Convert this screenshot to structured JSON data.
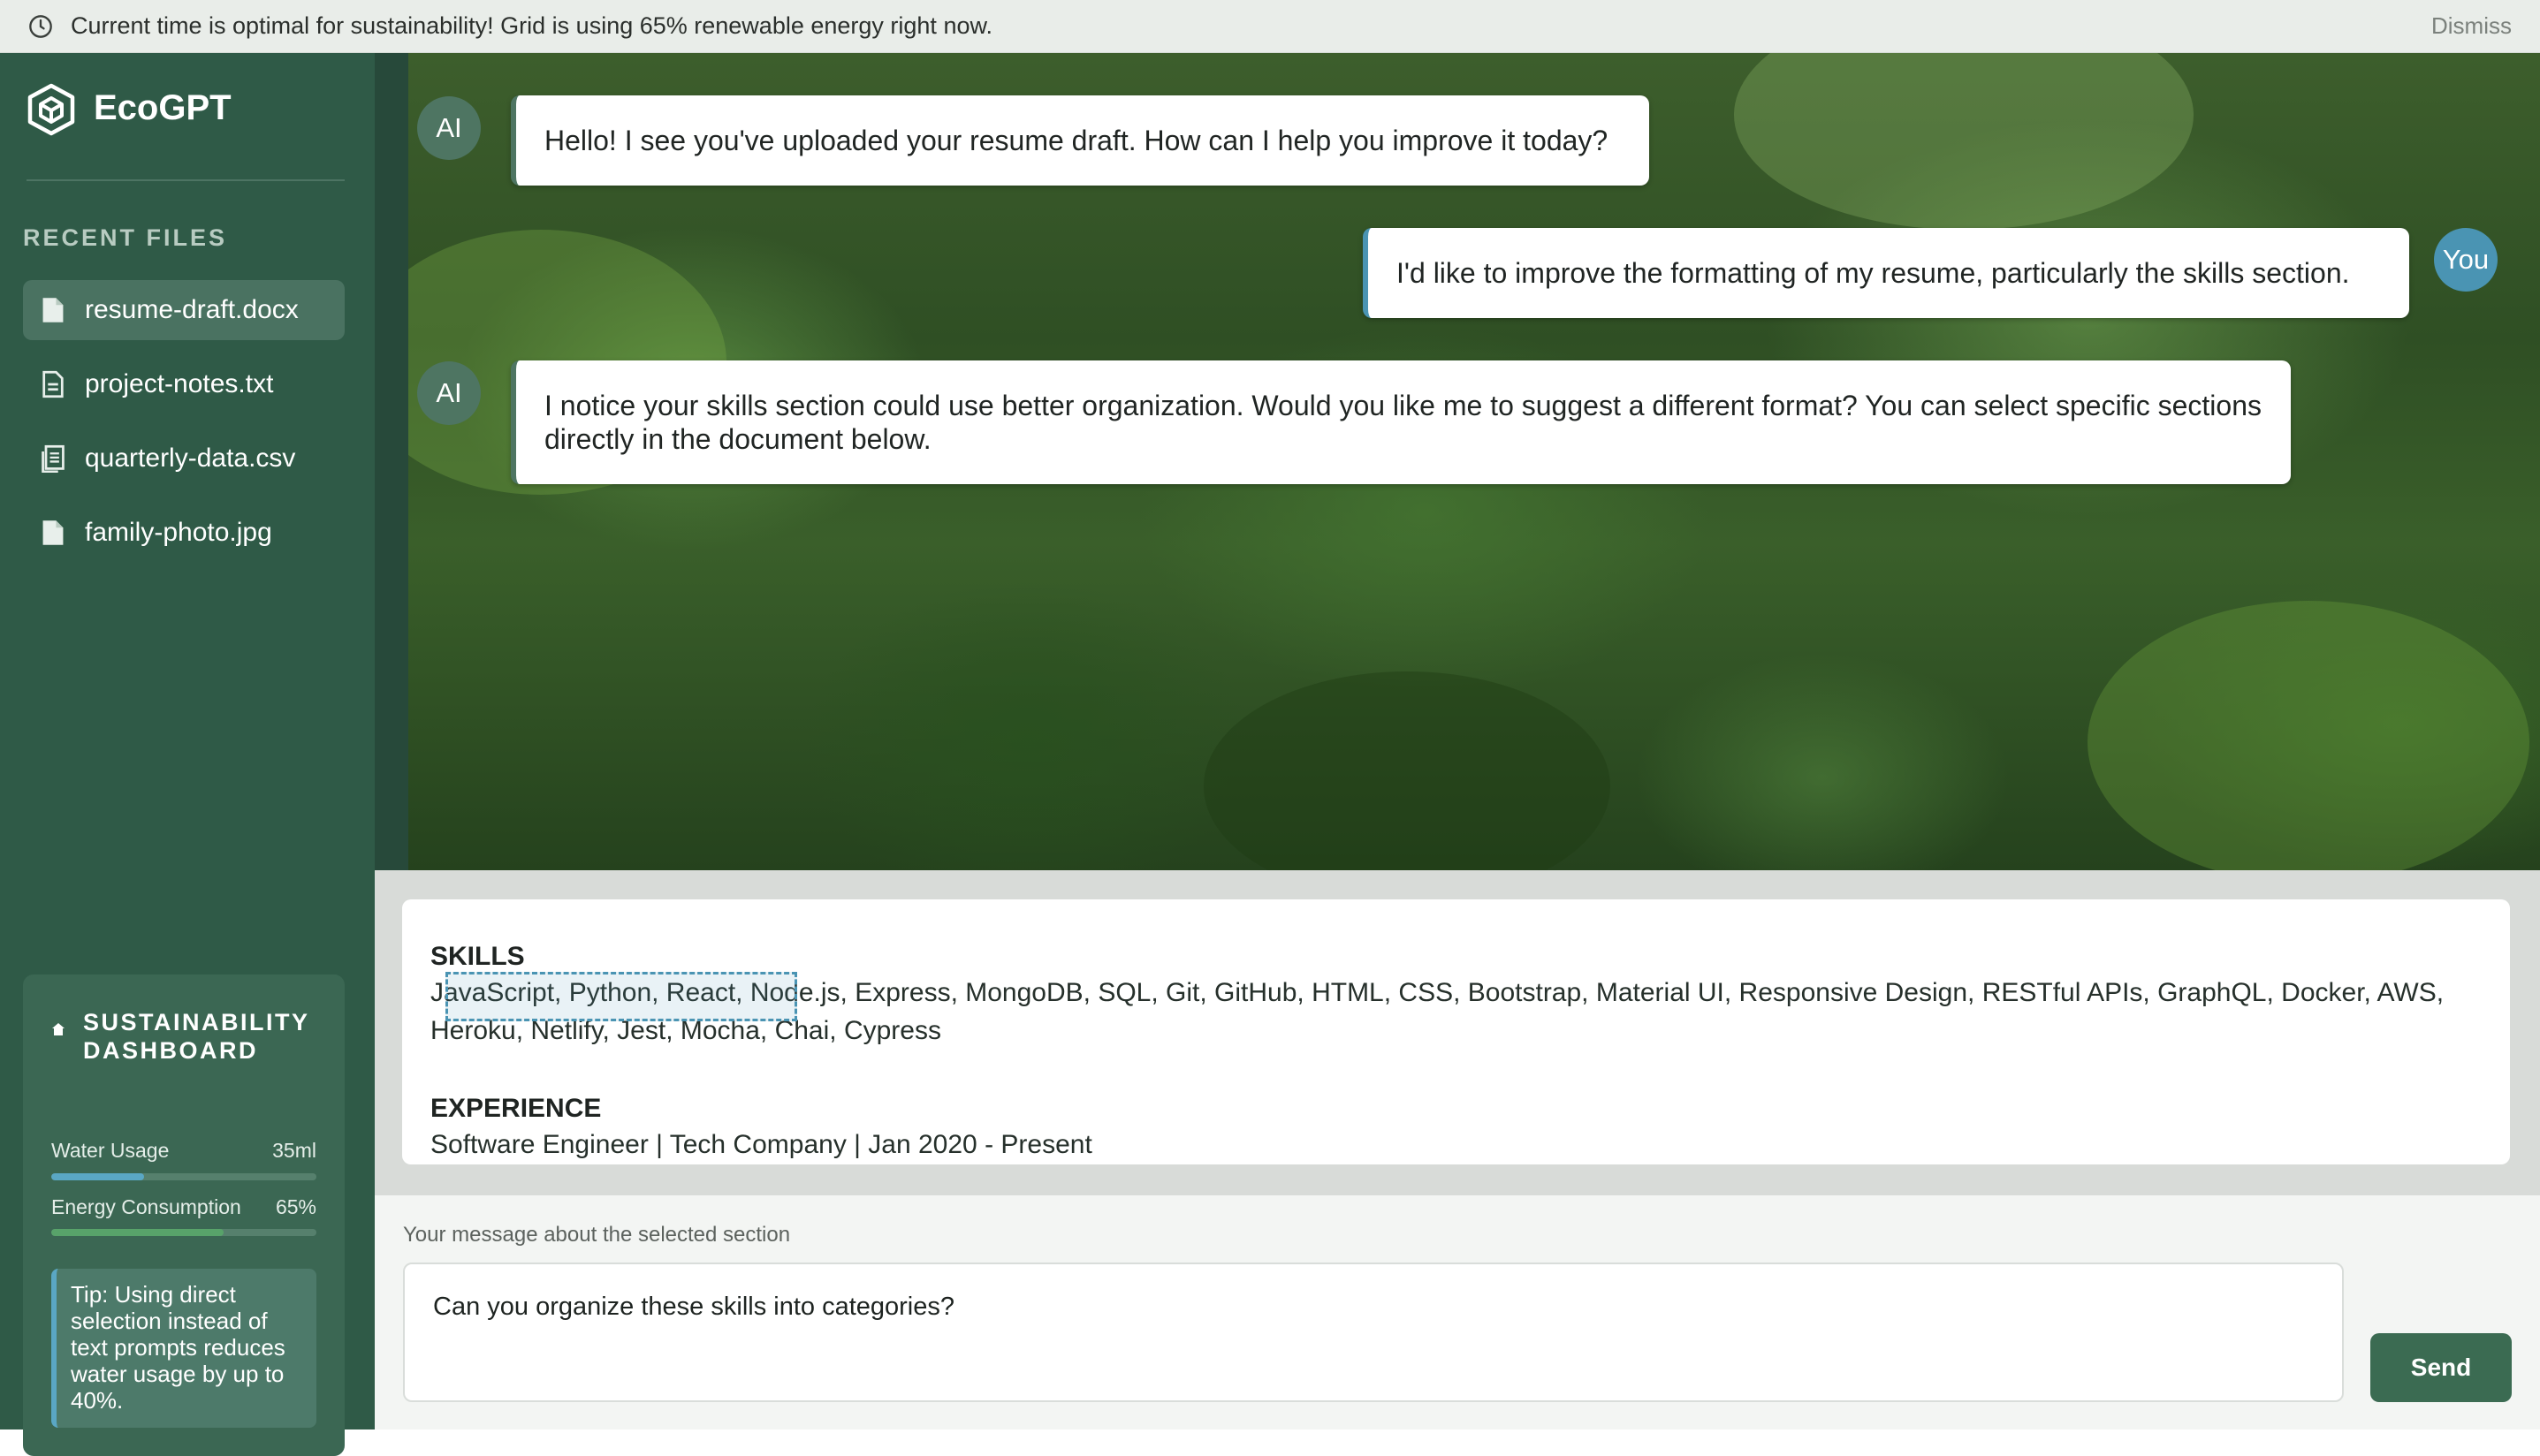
{
  "banner": {
    "icon": "clock-icon",
    "message": "Current time is optimal for sustainability! Grid is using 65% renewable energy right now.",
    "dismiss_label": "Dismiss"
  },
  "sidebar": {
    "app_name": "EcoGPT",
    "logo_icon": "hexagon-cube-logo",
    "recent_heading": "RECENT FILES",
    "files": [
      {
        "name": "resume-draft.docx",
        "icon": "file-icon",
        "active": true
      },
      {
        "name": "project-notes.txt",
        "icon": "text-file-icon",
        "active": false
      },
      {
        "name": "quarterly-data.csv",
        "icon": "data-file-icon",
        "active": false
      },
      {
        "name": "family-photo.jpg",
        "icon": "image-file-icon",
        "active": false
      }
    ],
    "dashboard": {
      "icon": "house-icon",
      "title": "SUSTAINABILITY DASHBOARD",
      "water_label": "Water Usage",
      "water_value": "35ml",
      "water_fraction": 0.35,
      "energy_label": "Energy Consumption",
      "energy_value": "65%",
      "energy_fraction": 0.65,
      "tip": "Tip: Using direct selection instead of text prompts reduces water usage by up to 40%."
    }
  },
  "chat": {
    "messages": [
      {
        "sender": "AI",
        "text": "Hello! I see you've uploaded your resume draft. How can I help you improve it today?"
      },
      {
        "sender": "You",
        "text": "I'd like to improve the formatting of my resume, particularly the skills section."
      },
      {
        "sender": "AI",
        "text": "I notice your skills section could use better organization. Would you like me to suggest a different format? You can select specific sections directly in the document below."
      }
    ]
  },
  "document": {
    "skills_heading": "SKILLS",
    "skills_text": "JavaScript, Python, React, Node.js, Express, MongoDB, SQL, Git, GitHub, HTML, CSS, Bootstrap, Material UI, Responsive Design, RESTful APIs, GraphQL, Docker, AWS, Heroku, Netlify, Jest, Mocha, Chai, Cypress",
    "experience_heading": "EXPERIENCE",
    "experience_text": "Software Engineer | Tech Company | Jan 2020 - Present"
  },
  "composer": {
    "label": "Your message about the selected section",
    "value": "Can you organize these skills into categories?",
    "send_label": "Send"
  },
  "colors": {
    "sidebar": "#2f5a47",
    "accent_green": "#3b6b52",
    "accent_blue": "#4a94b3"
  }
}
